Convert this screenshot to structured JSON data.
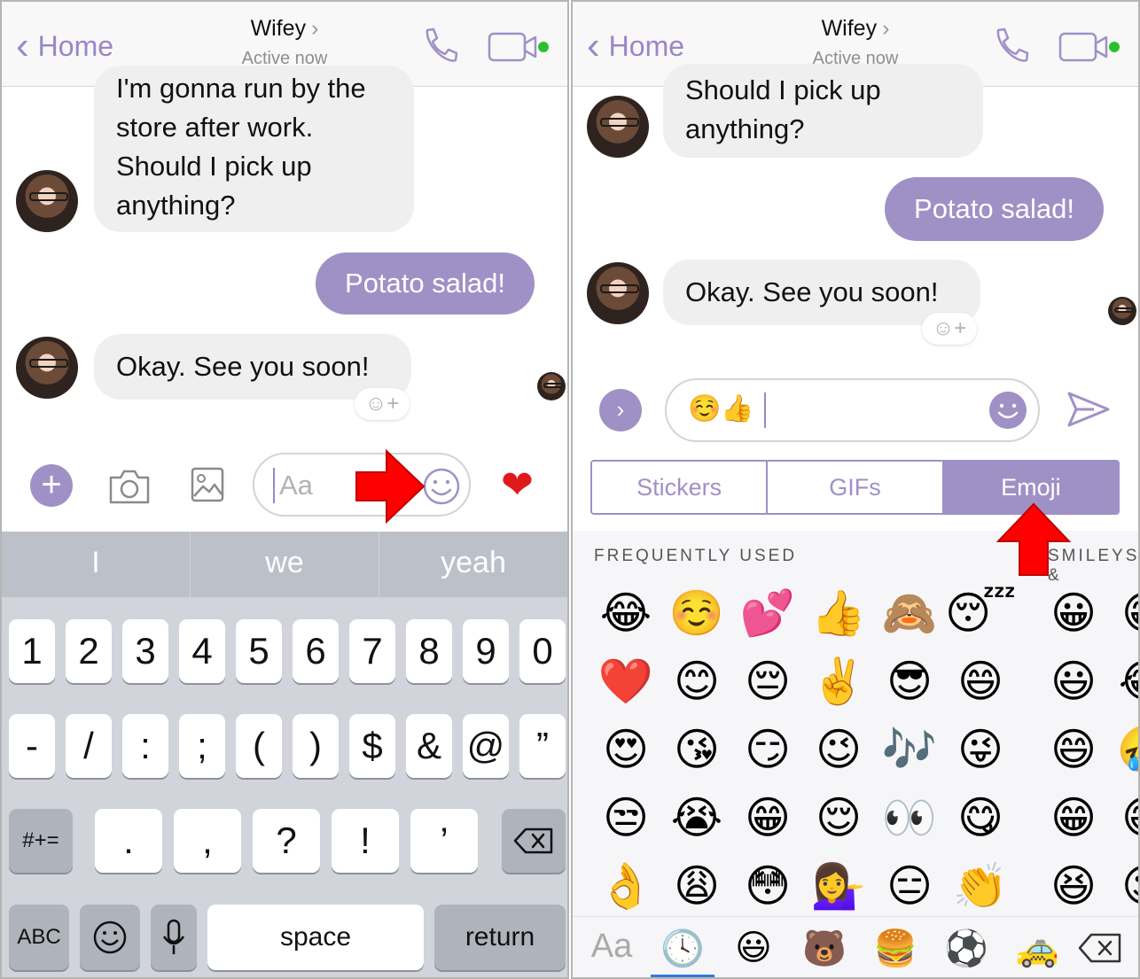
{
  "colors": {
    "accent": "#9f91c6",
    "red_arrow": "#ff0000",
    "online_dot": "#2bc02b"
  },
  "left": {
    "header": {
      "back_label": "Home",
      "contact_name": "Wifey",
      "status": "Active now"
    },
    "messages": {
      "incoming_1": [
        "I'm gonna run by the",
        "store after work.",
        "Should I pick up",
        "anything?"
      ],
      "outgoing_1": "Potato salad!",
      "incoming_2": "Okay. See you soon!"
    },
    "composer": {
      "placeholder": "Aa"
    },
    "keyboard": {
      "predictions": [
        "I",
        "we",
        "yeah"
      ],
      "row1": [
        "1",
        "2",
        "3",
        "4",
        "5",
        "6",
        "7",
        "8",
        "9",
        "0"
      ],
      "row2": [
        "-",
        "/",
        ":",
        ";",
        "(",
        ")",
        "$",
        "&",
        "@",
        "”"
      ],
      "row3": [
        ".",
        ",",
        "?",
        "!",
        "’"
      ],
      "row3_left": "#+=",
      "abc": "ABC",
      "space": "space",
      "return": "return"
    }
  },
  "right": {
    "header": {
      "back_label": "Home",
      "contact_name": "Wifey",
      "status": "Active now"
    },
    "messages": {
      "incoming_1": [
        "Should I pick up",
        "anything?"
      ],
      "outgoing_1": "Potato salad!",
      "incoming_2": "Okay. See you soon!"
    },
    "composer": {
      "value": "☺️👍"
    },
    "tabs": [
      "Stickers",
      "GIFs",
      "Emoji"
    ],
    "active_tab": "Emoji",
    "emoji_panel": {
      "section_frequent": "FREQUENTLY USED",
      "section_smileys": "SMILEYS &",
      "frequent": [
        [
          "😂",
          "☺️",
          "💕",
          "👍",
          "🙈",
          "😴"
        ],
        [
          "❤️",
          "😊",
          "😔",
          "✌️",
          "😎",
          "😄"
        ],
        [
          "😍",
          "😘",
          "😏",
          "😉",
          "🎶",
          "😜"
        ],
        [
          "😒",
          "😭",
          "😁",
          "😌",
          "👀",
          "😋"
        ],
        [
          "👌",
          "😩",
          "😳",
          "💁‍♀️",
          "😑",
          "👏"
        ]
      ],
      "smileys": [
        [
          "😀",
          "😁"
        ],
        [
          "😃",
          "😂"
        ],
        [
          "😄",
          "🤣"
        ],
        [
          "😁",
          "😅"
        ],
        [
          "😆",
          "😉"
        ]
      ],
      "categories": [
        "Aa",
        "🕓",
        "😃",
        "🐻",
        "🍔",
        "⚽",
        "🚕"
      ]
    }
  }
}
